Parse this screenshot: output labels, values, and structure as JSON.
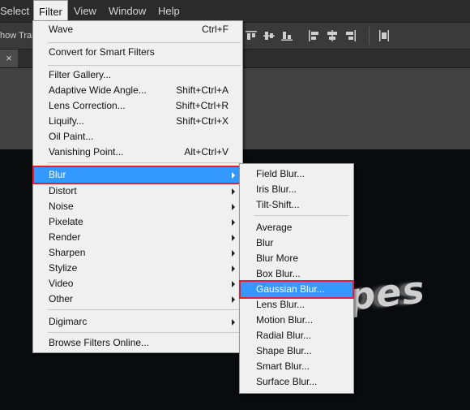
{
  "menubar": {
    "items": [
      "Select",
      "Filter",
      "View",
      "Window",
      "Help"
    ],
    "active": "Filter"
  },
  "optbar": {
    "label": "how Trans"
  },
  "tab": {
    "close_label": "×"
  },
  "canvas": {
    "text": "pes"
  },
  "filter_menu": {
    "last_filter": {
      "label": "Wave",
      "shortcut": "Ctrl+F"
    },
    "convert": "Convert for Smart Filters",
    "group1": [
      {
        "label": "Filter Gallery...",
        "shortcut": ""
      },
      {
        "label": "Adaptive Wide Angle...",
        "shortcut": "Shift+Ctrl+A"
      },
      {
        "label": "Lens Correction...",
        "shortcut": "Shift+Ctrl+R"
      },
      {
        "label": "Liquify...",
        "shortcut": "Shift+Ctrl+X"
      },
      {
        "label": "Oil Paint...",
        "shortcut": ""
      },
      {
        "label": "Vanishing Point...",
        "shortcut": "Alt+Ctrl+V"
      }
    ],
    "submenus": [
      "Blur",
      "Distort",
      "Noise",
      "Pixelate",
      "Render",
      "Sharpen",
      "Stylize",
      "Video",
      "Other"
    ],
    "highlighted": "Blur",
    "digimarc": "Digimarc",
    "browse": "Browse Filters Online..."
  },
  "blur_menu": {
    "group1": [
      "Field Blur...",
      "Iris Blur...",
      "Tilt-Shift..."
    ],
    "group2": [
      "Average",
      "Blur",
      "Blur More",
      "Box Blur...",
      "Gaussian Blur...",
      "Lens Blur...",
      "Motion Blur...",
      "Radial Blur...",
      "Shape Blur...",
      "Smart Blur...",
      "Surface Blur..."
    ],
    "highlighted": "Gaussian Blur..."
  },
  "colors": {
    "highlight": "#3399ff",
    "callout": "#e0203a",
    "menu_bg": "#f0f0f0"
  }
}
